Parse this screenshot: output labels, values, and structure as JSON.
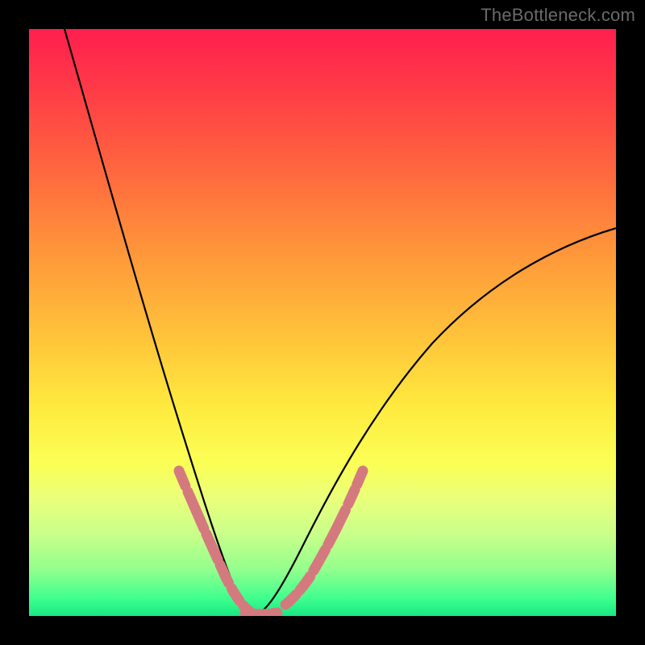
{
  "watermark": "TheBottleneck.com",
  "chart_data": {
    "type": "line",
    "title": "",
    "xlabel": "",
    "ylabel": "",
    "xlim": [
      0,
      1
    ],
    "ylim": [
      0,
      1
    ],
    "grid": false,
    "legend": false,
    "annotations": [],
    "series": [
      {
        "name": "curve",
        "color": "#000000",
        "x": [
          0.06,
          0.1,
          0.14,
          0.18,
          0.22,
          0.26,
          0.28,
          0.3,
          0.32,
          0.34,
          0.35,
          0.36,
          0.38,
          0.42,
          0.46,
          0.5,
          0.54,
          0.6,
          0.66,
          0.74,
          0.82,
          0.9,
          1.0
        ],
        "y": [
          1.0,
          0.82,
          0.66,
          0.5,
          0.36,
          0.22,
          0.16,
          0.11,
          0.06,
          0.03,
          0.015,
          0.005,
          0.0,
          0.02,
          0.06,
          0.12,
          0.19,
          0.29,
          0.38,
          0.48,
          0.55,
          0.61,
          0.66
        ]
      },
      {
        "name": "markers",
        "color": "#d47a7f",
        "x": [
          0.255,
          0.265,
          0.275,
          0.285,
          0.295,
          0.305,
          0.315,
          0.325,
          0.335,
          0.345,
          0.355,
          0.365,
          0.375,
          0.395,
          0.415,
          0.435,
          0.46,
          0.485,
          0.505,
          0.525,
          0.545,
          0.565
        ],
        "y": [
          0.24,
          0.21,
          0.18,
          0.15,
          0.125,
          0.1,
          0.08,
          0.06,
          0.045,
          0.03,
          0.018,
          0.01,
          0.005,
          0.005,
          0.02,
          0.04,
          0.07,
          0.105,
          0.14,
          0.175,
          0.21,
          0.245
        ]
      }
    ],
    "background_gradient_stops": [
      {
        "pos": 0.0,
        "color": "#ff1f4e"
      },
      {
        "pos": 0.1,
        "color": "#ff3a47"
      },
      {
        "pos": 0.25,
        "color": "#ff6a3e"
      },
      {
        "pos": 0.38,
        "color": "#ff963a"
      },
      {
        "pos": 0.52,
        "color": "#ffc23a"
      },
      {
        "pos": 0.64,
        "color": "#ffe93e"
      },
      {
        "pos": 0.74,
        "color": "#fbff55"
      },
      {
        "pos": 0.8,
        "color": "#eaff7b"
      },
      {
        "pos": 0.86,
        "color": "#c9ff8a"
      },
      {
        "pos": 0.92,
        "color": "#94ff8d"
      },
      {
        "pos": 0.97,
        "color": "#3fff8e"
      },
      {
        "pos": 1.0,
        "color": "#18e884"
      }
    ]
  }
}
